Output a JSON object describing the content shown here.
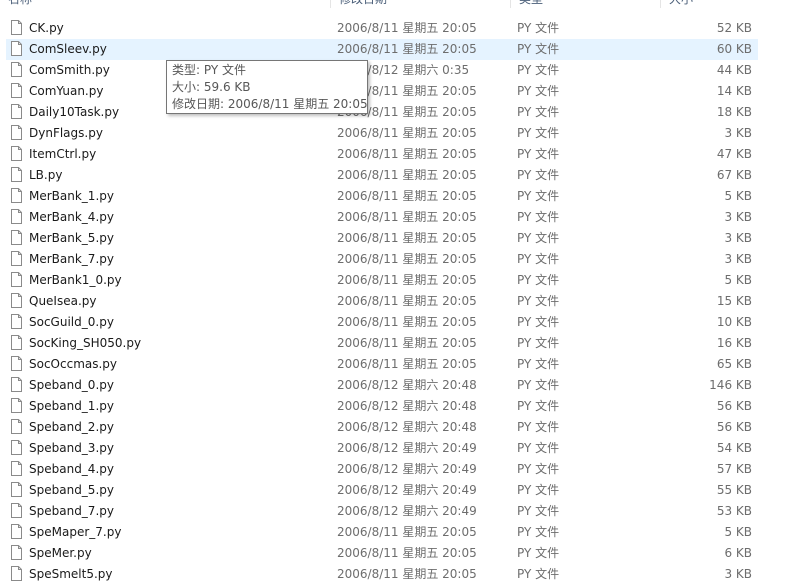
{
  "columns": {
    "name": "名称",
    "date": "修改日期",
    "type": "类型",
    "size": "大小"
  },
  "files": [
    {
      "name": "CK.py",
      "date": "2006/8/11 星期五 20:05",
      "type": "PY 文件",
      "size": "52 KB"
    },
    {
      "name": "ComSleev.py",
      "date": "2006/8/11 星期五 20:05",
      "type": "PY 文件",
      "size": "60 KB"
    },
    {
      "name": "ComSmith.py",
      "date": "2006/8/12 星期六 0:35",
      "type": "PY 文件",
      "size": "44 KB"
    },
    {
      "name": "ComYuan.py",
      "date": "2006/8/11 星期五 20:05",
      "type": "PY 文件",
      "size": "14 KB"
    },
    {
      "name": "Daily10Task.py",
      "date": "2006/8/11 星期五 20:05",
      "type": "PY 文件",
      "size": "18 KB"
    },
    {
      "name": "DynFlags.py",
      "date": "2006/8/11 星期五 20:05",
      "type": "PY 文件",
      "size": "3 KB"
    },
    {
      "name": "ItemCtrl.py",
      "date": "2006/8/11 星期五 20:05",
      "type": "PY 文件",
      "size": "47 KB"
    },
    {
      "name": "LB.py",
      "date": "2006/8/11 星期五 20:05",
      "type": "PY 文件",
      "size": "67 KB"
    },
    {
      "name": "MerBank_1.py",
      "date": "2006/8/11 星期五 20:05",
      "type": "PY 文件",
      "size": "5 KB"
    },
    {
      "name": "MerBank_4.py",
      "date": "2006/8/11 星期五 20:05",
      "type": "PY 文件",
      "size": "3 KB"
    },
    {
      "name": "MerBank_5.py",
      "date": "2006/8/11 星期五 20:05",
      "type": "PY 文件",
      "size": "3 KB"
    },
    {
      "name": "MerBank_7.py",
      "date": "2006/8/11 星期五 20:05",
      "type": "PY 文件",
      "size": "3 KB"
    },
    {
      "name": "MerBank1_0.py",
      "date": "2006/8/11 星期五 20:05",
      "type": "PY 文件",
      "size": "5 KB"
    },
    {
      "name": "QueIsea.py",
      "date": "2006/8/11 星期五 20:05",
      "type": "PY 文件",
      "size": "15 KB"
    },
    {
      "name": "SocGuild_0.py",
      "date": "2006/8/11 星期五 20:05",
      "type": "PY 文件",
      "size": "10 KB"
    },
    {
      "name": "SocKing_SH050.py",
      "date": "2006/8/11 星期五 20:05",
      "type": "PY 文件",
      "size": "16 KB"
    },
    {
      "name": "SocOccmas.py",
      "date": "2006/8/11 星期五 20:05",
      "type": "PY 文件",
      "size": "65 KB"
    },
    {
      "name": "Speband_0.py",
      "date": "2006/8/12 星期六 20:48",
      "type": "PY 文件",
      "size": "146 KB"
    },
    {
      "name": "Speband_1.py",
      "date": "2006/8/12 星期六 20:48",
      "type": "PY 文件",
      "size": "56 KB"
    },
    {
      "name": "Speband_2.py",
      "date": "2006/8/12 星期六 20:48",
      "type": "PY 文件",
      "size": "56 KB"
    },
    {
      "name": "Speband_3.py",
      "date": "2006/8/12 星期六 20:49",
      "type": "PY 文件",
      "size": "54 KB"
    },
    {
      "name": "Speband_4.py",
      "date": "2006/8/12 星期六 20:49",
      "type": "PY 文件",
      "size": "57 KB"
    },
    {
      "name": "Speband_5.py",
      "date": "2006/8/12 星期六 20:49",
      "type": "PY 文件",
      "size": "55 KB"
    },
    {
      "name": "Speband_7.py",
      "date": "2006/8/12 星期六 20:49",
      "type": "PY 文件",
      "size": "53 KB"
    },
    {
      "name": "SpeMaper_7.py",
      "date": "2006/8/11 星期五 20:05",
      "type": "PY 文件",
      "size": "5 KB"
    },
    {
      "name": "SpeMer.py",
      "date": "2006/8/11 星期五 20:05",
      "type": "PY 文件",
      "size": "6 KB"
    },
    {
      "name": "SpeSmelt5.py",
      "date": "2006/8/11 星期五 20:05",
      "type": "PY 文件",
      "size": "3 KB"
    }
  ],
  "hovered_index": 1,
  "tooltip": {
    "type_line": "类型: PY 文件",
    "size_line": "大小: 59.6 KB",
    "date_line": "修改日期: 2006/8/11 星期五 20:05"
  },
  "colors": {
    "hover_bg": "#e5f3ff",
    "header_text": "#4c607a",
    "detail_text": "#6d6d6d"
  }
}
